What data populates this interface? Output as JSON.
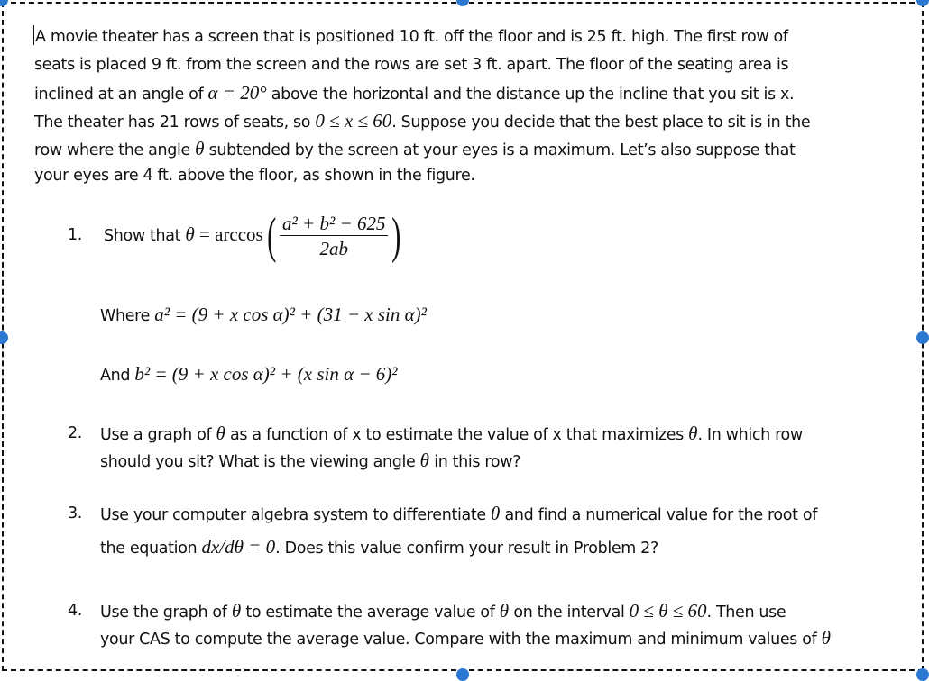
{
  "document": {
    "intro_lines": [
      "A movie theater has a screen that is positioned 10 ft. off the floor and is 25 ft. high.  The first row of",
      "seats is placed 9 ft. from the screen and the rows are set 3 ft. apart.  The floor of the seating area is",
      {
        "pre": "inclined at an angle of ",
        "math": "α = 20°",
        "post": " above the horizontal and the distance up the incline that you sit is x."
      },
      {
        "pre": "The theater has 21 rows of seats, so ",
        "math": "0 ≤ x ≤ 60",
        "post": ".  Suppose you decide that the best place to sit is in the"
      },
      {
        "pre": "row where the angle ",
        "math": "θ",
        "post": " subtended by the screen at your eyes is a maximum.  Let’s also suppose that"
      },
      "your eyes are 4 ft. above the floor, as shown in the figure."
    ],
    "problems": [
      {
        "number": "1.",
        "text": "Show that",
        "formula": {
          "lhs": "θ",
          "func": "arccos",
          "numerator": "a² + b² − 625",
          "denominator": "2ab"
        },
        "where_label": "Where",
        "where_formula": "a² = (9 + x cos α)² + (31 − x sin α)²",
        "and_label": "And",
        "and_formula": "b² = (9 + x cos α)² + (x sin α − 6)²"
      },
      {
        "number": "2.",
        "lines": [
          {
            "pre": "Use a graph of ",
            "math": "θ",
            "mid": " as a function of x to estimate the value of x that maximizes ",
            "math2": "θ",
            "post": ".  In which row"
          },
          {
            "pre": "should you sit?  What is the viewing angle ",
            "math": "θ",
            "post": " in this row?"
          }
        ]
      },
      {
        "number": "3.",
        "lines": [
          {
            "pre": "Use your computer algebra system to differentiate ",
            "math": "θ",
            "post": " and find a numerical value for the root of"
          },
          {
            "pre": "the equation ",
            "math": "dx/dθ = 0",
            "post": ".  Does this value confirm your result in Problem 2?"
          }
        ]
      },
      {
        "number": "4.",
        "lines": [
          {
            "pre": "Use the graph of ",
            "math": "θ",
            "mid": " to estimate the average value of ",
            "math2": "θ",
            "mid2": " on the interval ",
            "math3": "0 ≤ θ ≤ 60",
            "post": ".  Then use"
          },
          {
            "pre": "your CAS to compute the average value.  Compare with the maximum and minimum values of ",
            "math": "θ"
          }
        ]
      }
    ]
  },
  "selection": {
    "accent_color": "#2a78d0",
    "border_style": "dashed"
  }
}
